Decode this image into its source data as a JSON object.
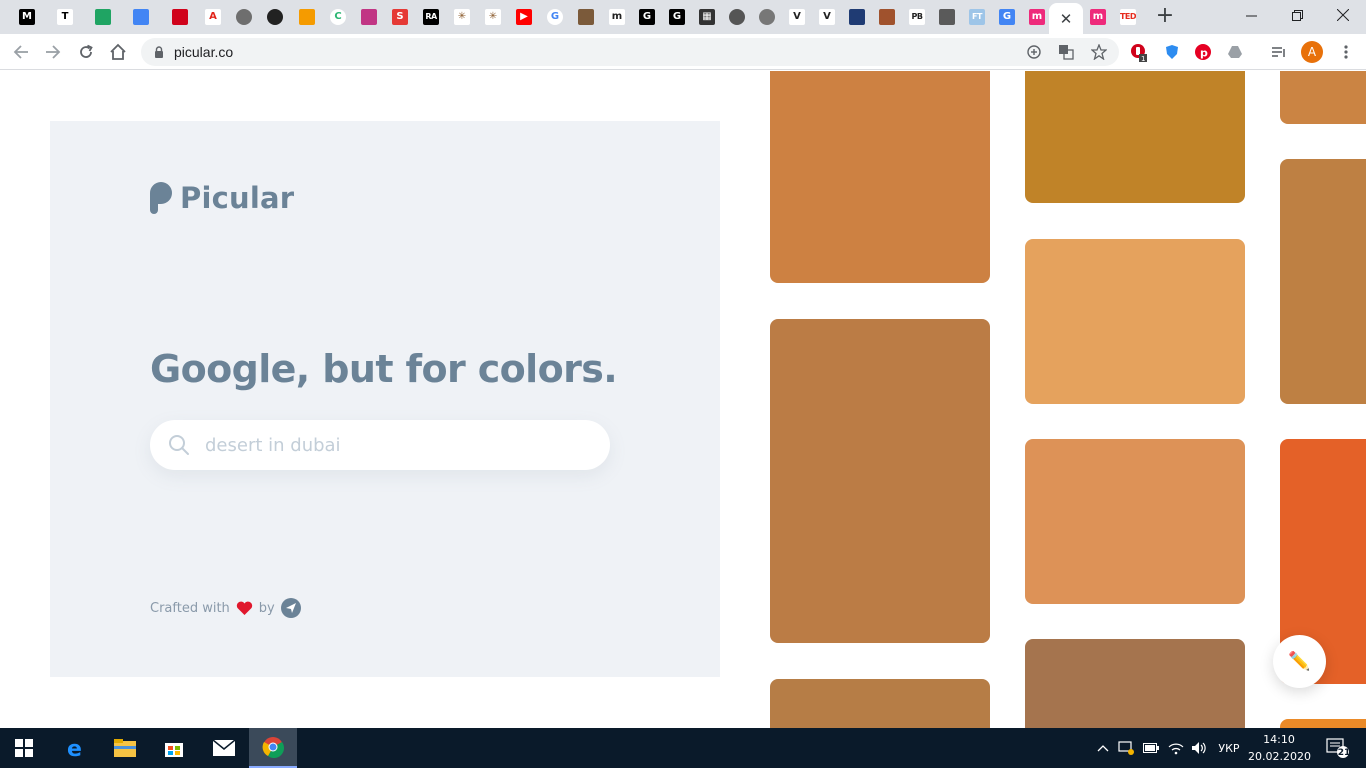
{
  "browser": {
    "tabs": [
      {
        "icon": "medium-icon",
        "glyph": "M",
        "bg": "#000000",
        "fg": "#ffffff"
      },
      {
        "icon": "typora-icon",
        "glyph": "T",
        "bg": "#ffffff",
        "fg": "#000000"
      },
      {
        "icon": "google-drive-icon",
        "glyph": "",
        "bg": "#1fa463",
        "fg": "#ffffff"
      },
      {
        "icon": "google-docs-icon",
        "glyph": "",
        "bg": "#4285f4",
        "fg": "#ffffff"
      },
      {
        "icon": "red-app-icon",
        "glyph": "",
        "bg": "#d0021b",
        "fg": "#ffffff"
      },
      {
        "icon": "adobe-icon",
        "glyph": "A",
        "bg": "#ffffff",
        "fg": "#e1251b"
      },
      {
        "icon": "grey-globe-icon",
        "glyph": "",
        "bg": "#6e6e6e",
        "fg": "#ffffff",
        "round": true
      },
      {
        "icon": "github-icon",
        "glyph": "",
        "bg": "#222222",
        "fg": "#ffffff",
        "round": true
      },
      {
        "icon": "orange-square-icon",
        "glyph": "",
        "bg": "#f59b00",
        "fg": "#ffffff"
      },
      {
        "icon": "colorful-c-icon",
        "glyph": "C",
        "bg": "#ffffff",
        "fg": "#2bb673",
        "round": true
      },
      {
        "icon": "instagram-icon",
        "glyph": "",
        "bg": "#c13584",
        "fg": "#ffffff"
      },
      {
        "icon": "slides-icon",
        "glyph": "S",
        "bg": "#e53935",
        "fg": "#ffffff"
      },
      {
        "icon": "ra-icon",
        "glyph": "RA",
        "bg": "#000000",
        "fg": "#ffffff",
        "txt": true
      },
      {
        "icon": "sparkle-icon",
        "glyph": "✳",
        "bg": "#ffffff",
        "fg": "#8a5a2b"
      },
      {
        "icon": "sparkle-icon",
        "glyph": "✳",
        "bg": "#ffffff",
        "fg": "#8a5a2b"
      },
      {
        "icon": "youtube-icon",
        "glyph": "▶",
        "bg": "#ff0000",
        "fg": "#ffffff"
      },
      {
        "icon": "google-icon",
        "glyph": "G",
        "bg": "#ffffff",
        "fg": "#4285f4",
        "round": true
      },
      {
        "icon": "picture-icon",
        "glyph": "",
        "bg": "#7b5a3a",
        "fg": "#ffffff"
      },
      {
        "icon": "m-icon",
        "glyph": "m",
        "bg": "#ffffff",
        "fg": "#222222"
      },
      {
        "icon": "g-black-icon",
        "glyph": "G",
        "bg": "#000000",
        "fg": "#ffffff"
      },
      {
        "icon": "g-black-icon",
        "glyph": "G",
        "bg": "#000000",
        "fg": "#ffffff"
      },
      {
        "icon": "grid-icon",
        "glyph": "▦",
        "bg": "#333333",
        "fg": "#ffffff"
      },
      {
        "icon": "globe-icon",
        "glyph": "",
        "bg": "#555555",
        "fg": "#ffffff",
        "round": true
      },
      {
        "icon": "badge-icon",
        "glyph": "",
        "bg": "#777777",
        "fg": "#ffffff",
        "round": true
      },
      {
        "icon": "v-icon",
        "glyph": "V",
        "bg": "#ffffff",
        "fg": "#222222"
      },
      {
        "icon": "v-icon",
        "glyph": "V",
        "bg": "#ffffff",
        "fg": "#222222"
      },
      {
        "icon": "blue-square-icon",
        "glyph": "",
        "bg": "#1f3b73",
        "fg": "#ffffff"
      },
      {
        "icon": "picture-icon",
        "glyph": "",
        "bg": "#a0522d",
        "fg": "#ffffff"
      },
      {
        "icon": "pb-icon",
        "glyph": "PB",
        "bg": "#ffffff",
        "fg": "#222222",
        "txt": true
      },
      {
        "icon": "photo-icon",
        "glyph": "",
        "bg": "#5a5a5a",
        "fg": "#ffffff"
      },
      {
        "icon": "ft-icon",
        "glyph": "FT",
        "bg": "#9ec5e8",
        "fg": "#ffffff",
        "txt": true
      },
      {
        "icon": "translate-icon",
        "glyph": "G",
        "bg": "#4285f4",
        "fg": "#ffffff"
      },
      {
        "icon": "m-pink-icon",
        "glyph": "m",
        "bg": "#ee2a7b",
        "fg": "#ffffff"
      },
      {
        "icon": "close-tab-icon",
        "active": true
      },
      {
        "icon": "m-pink-icon",
        "glyph": "m",
        "bg": "#ee2a7b",
        "fg": "#ffffff"
      },
      {
        "icon": "ted-icon",
        "glyph": "TED",
        "bg": "#ffffff",
        "fg": "#e62b1e",
        "txt": true
      }
    ],
    "new_tab": "+",
    "url": "picular.co",
    "profile_initial": "A"
  },
  "page": {
    "logo_text": "Picular",
    "headline": "Google, but for colors.",
    "search_placeholder": "desert in dubai",
    "crafted_with": "Crafted with",
    "crafted_by": "by",
    "fab_glyph": "✏️"
  },
  "swatch_colors": [
    "#cd8142",
    "#c08328",
    "#cb8443",
    "#bb7c45",
    "#e5a25d",
    "#be8043",
    "#b67d46",
    "#dd9257",
    "#e46128",
    "#c0773f",
    "#a5744e",
    "#ea8a28"
  ],
  "taskbar": {
    "language": "УКР",
    "time": "14:10",
    "date": "20.02.2020",
    "notifications": "21"
  }
}
